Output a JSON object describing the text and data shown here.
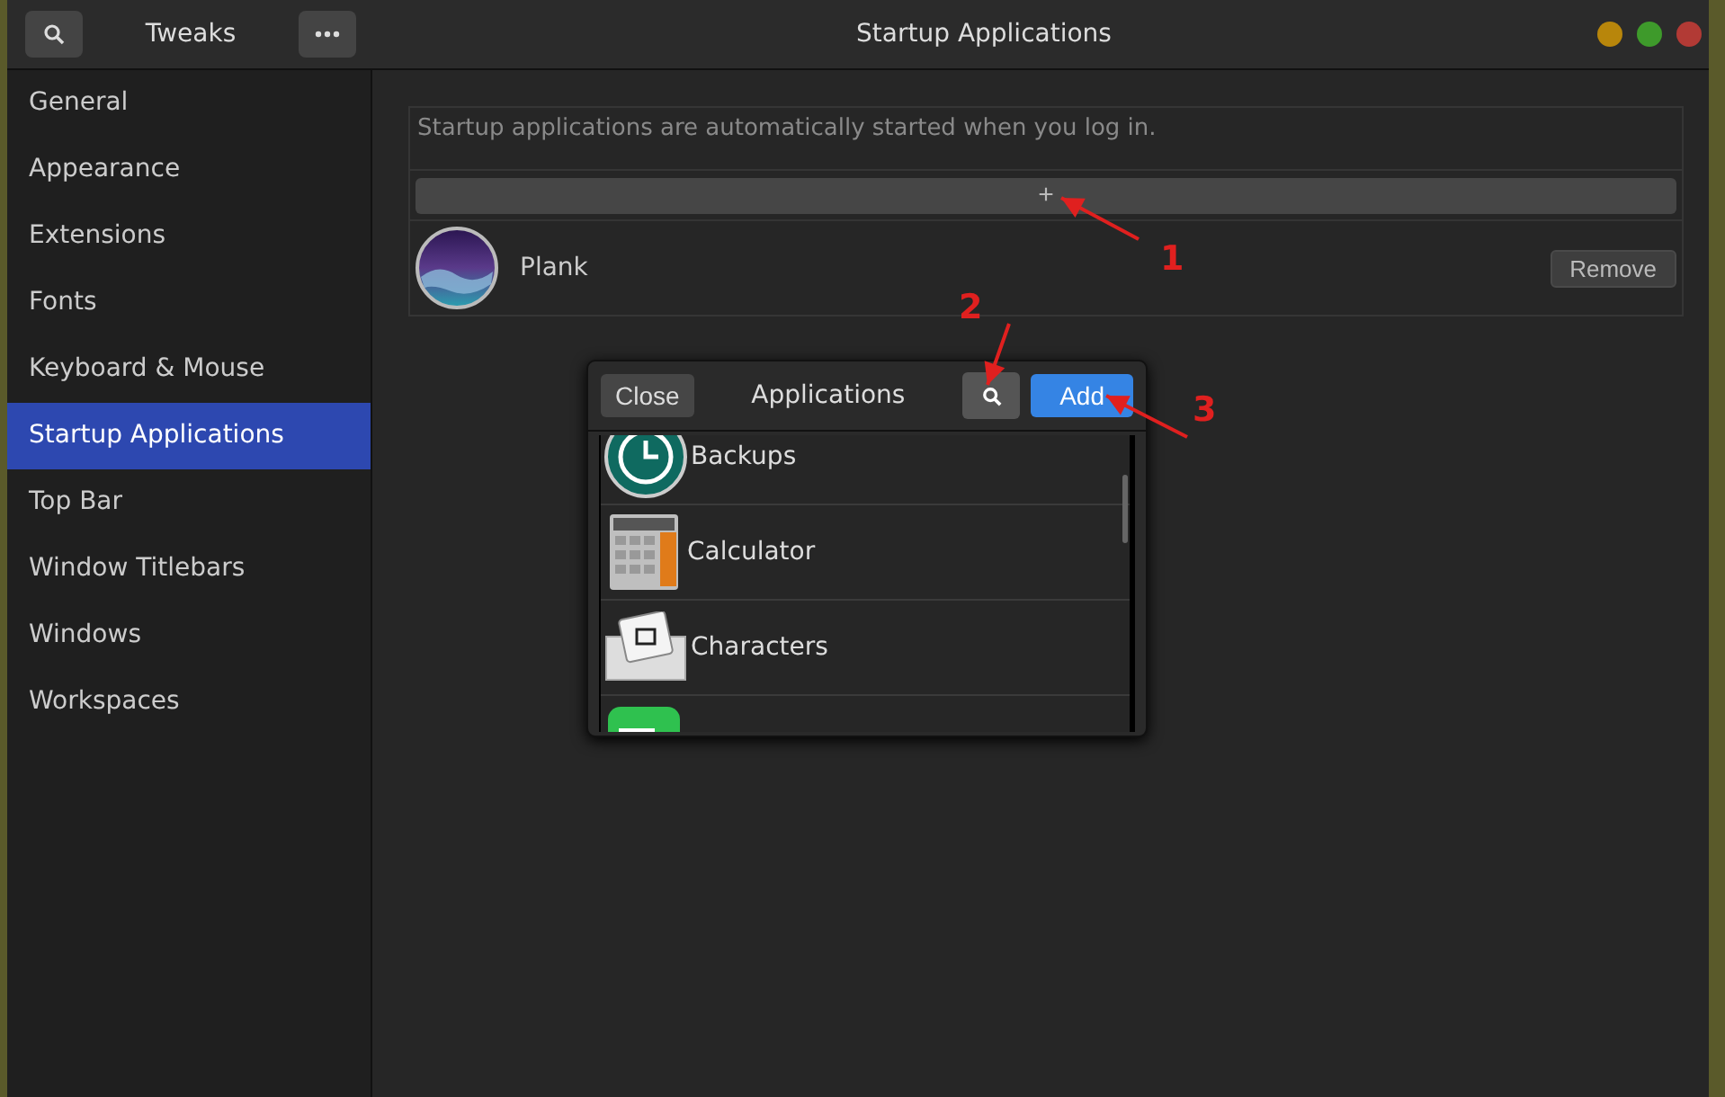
{
  "window": {
    "title": "Startup Applications",
    "app_title": "Tweaks"
  },
  "sidebar": {
    "items": [
      {
        "label": "General",
        "selected": false
      },
      {
        "label": "Appearance",
        "selected": false
      },
      {
        "label": "Extensions",
        "selected": false
      },
      {
        "label": "Fonts",
        "selected": false
      },
      {
        "label": "Keyboard & Mouse",
        "selected": false
      },
      {
        "label": "Startup Applications",
        "selected": true
      },
      {
        "label": "Top Bar",
        "selected": false
      },
      {
        "label": "Window Titlebars",
        "selected": false
      },
      {
        "label": "Windows",
        "selected": false
      },
      {
        "label": "Workspaces",
        "selected": false
      }
    ]
  },
  "content": {
    "description": "Startup applications are automatically started when you log in.",
    "add_button": "+",
    "apps": [
      {
        "name": "Plank",
        "button": "Remove"
      }
    ]
  },
  "dialog": {
    "close": "Close",
    "title": "Applications",
    "add": "Add",
    "items": [
      {
        "name": "Backups"
      },
      {
        "name": "Calculator"
      },
      {
        "name": "Characters"
      }
    ]
  },
  "annotations": [
    {
      "label": "1"
    },
    {
      "label": "2"
    },
    {
      "label": "3"
    }
  ]
}
